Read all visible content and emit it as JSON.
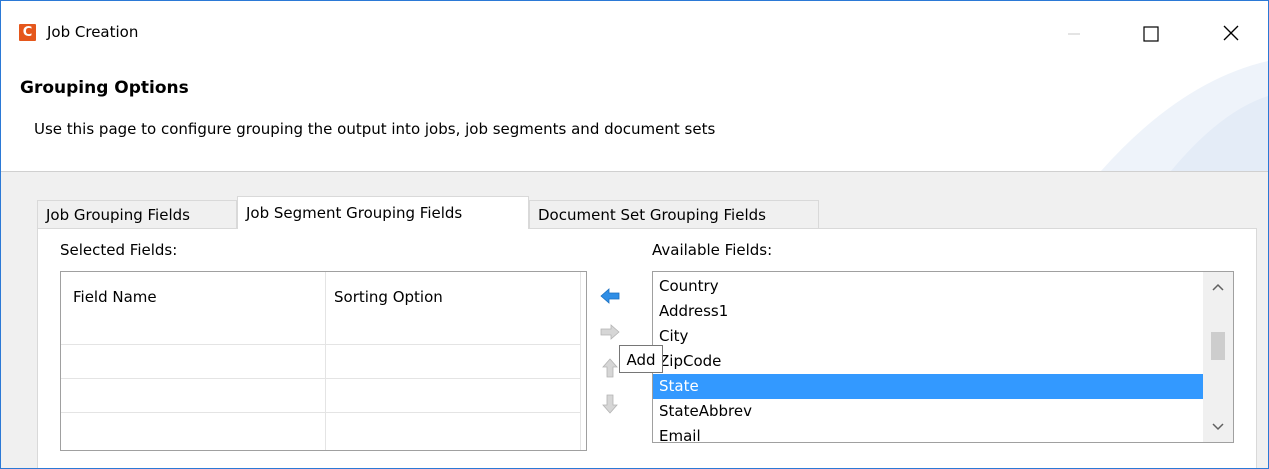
{
  "window": {
    "title": "Job Creation",
    "icon_letter": "C",
    "icon_color": "#e5571c",
    "controls": [
      "minimize-icon",
      "maximize-icon",
      "close-icon"
    ]
  },
  "header": {
    "title": "Grouping Options",
    "description": "Use this page to configure grouping the output into jobs, job segments and document sets"
  },
  "tabs": [
    {
      "label": "Job Grouping Fields",
      "active": false
    },
    {
      "label": "Job Segment Grouping Fields",
      "active": true
    },
    {
      "label": "Document Set Grouping Fields",
      "active": false
    }
  ],
  "selected_fields": {
    "label": "Selected Fields:",
    "columns": [
      "Field Name",
      "Sorting Option"
    ],
    "rows": []
  },
  "buttons": {
    "add_icon": "arrow-left-icon",
    "remove_icon": "arrow-right-icon",
    "move_up_icon": "arrow-up-icon",
    "move_down_icon": "arrow-down-icon",
    "tooltip": "Add"
  },
  "available_fields": {
    "label": "Available Fields:",
    "items": [
      "Country",
      "Address1",
      "City",
      "ZipCode",
      "State",
      "StateAbbrev",
      "Email"
    ],
    "selected": "State",
    "selection_color": "#3399ff"
  }
}
